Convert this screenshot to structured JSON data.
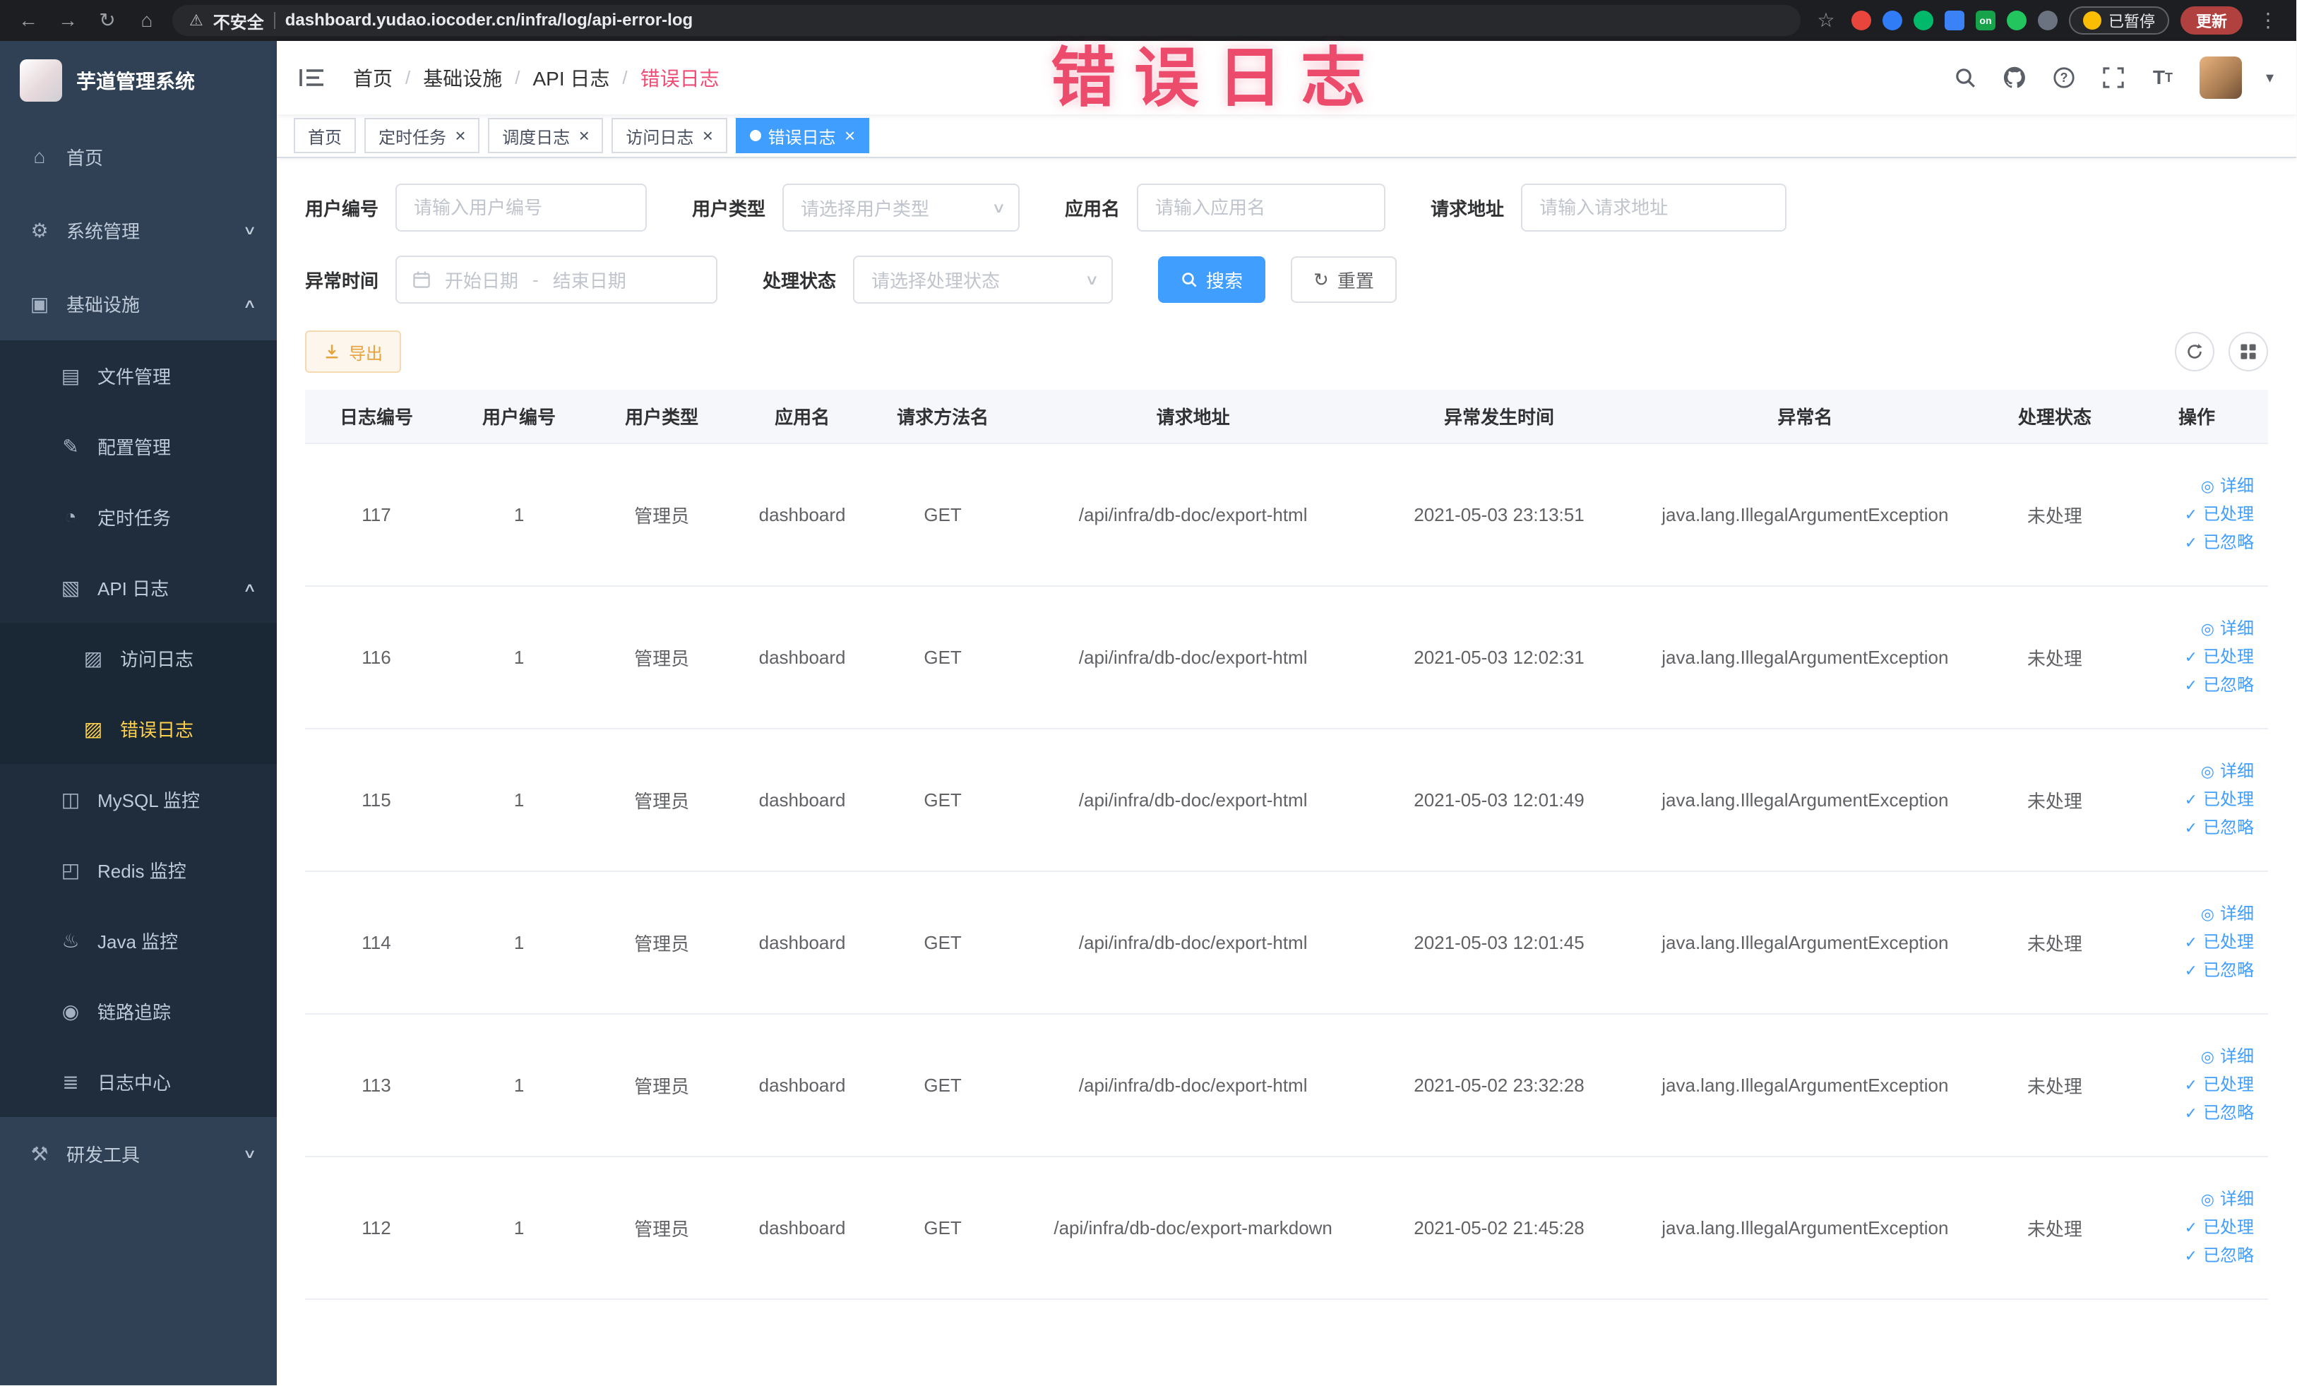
{
  "theme": {
    "primary": "#409eff",
    "warning": "#e6a23c",
    "sidebar_active": "#ffd04b",
    "annotation": "#ec4b6c"
  },
  "browser": {
    "security_label": "不安全",
    "url": "dashboard.yudao.iocoder.cn/infra/log/api-error-log",
    "paused_badge": "已暂停",
    "update_button": "更新",
    "extensions": [
      {
        "name": "extension-icon-red-circle",
        "color": "#e8453c",
        "shape": "circle"
      },
      {
        "name": "extension-icon-blue-drop",
        "color": "#2f7cf6",
        "shape": "circle"
      },
      {
        "name": "extension-icon-green-circle",
        "color": "#00b96b",
        "shape": "circle"
      },
      {
        "name": "extension-icon-blue-grid",
        "color": "#3b82f6",
        "shape": "square"
      },
      {
        "name": "extension-icon-on-badge",
        "color": "#16a34a",
        "shape": "square",
        "label": "on"
      },
      {
        "name": "extension-icon-green-leaf",
        "color": "#22c55e",
        "shape": "circle"
      },
      {
        "name": "extension-icon-dark-pin",
        "color": "#6b7280",
        "shape": "circle"
      }
    ]
  },
  "sidebar": {
    "logo_title": "芋道管理系统",
    "items": [
      {
        "key": "home",
        "label": "首页",
        "icon": "home-icon",
        "glyph": "home",
        "level": 1
      },
      {
        "key": "system",
        "label": "系统管理",
        "icon": "gear-icon",
        "glyph": "gear",
        "level": 1,
        "chevron": "down"
      },
      {
        "key": "infra",
        "label": "基础设施",
        "icon": "infra-icon",
        "glyph": "tree",
        "level": 1,
        "chevron": "up"
      },
      {
        "key": "file",
        "label": "文件管理",
        "icon": "file-manage-icon",
        "glyph": "folder",
        "level": 2
      },
      {
        "key": "config",
        "label": "配置管理",
        "icon": "config-edit-icon",
        "glyph": "edit",
        "level": 2
      },
      {
        "key": "job",
        "label": "定时任务",
        "icon": "timer-icon",
        "glyph": "clock",
        "level": 2
      },
      {
        "key": "api-log",
        "label": "API 日志",
        "icon": "api-log-icon",
        "glyph": "doc",
        "level": 2,
        "chevron": "up"
      },
      {
        "key": "access-log",
        "label": "访问日志",
        "icon": "access-log-icon",
        "glyph": "doc2",
        "level": 3
      },
      {
        "key": "error-log",
        "label": "错误日志",
        "icon": "error-log-icon",
        "glyph": "doc2",
        "level": 3,
        "active": true
      },
      {
        "key": "mysql",
        "label": "MySQL 监控",
        "icon": "mysql-monitor-icon",
        "glyph": "db",
        "level": 2
      },
      {
        "key": "redis",
        "label": "Redis 监控",
        "icon": "redis-monitor-icon",
        "glyph": "db2",
        "level": 2
      },
      {
        "key": "java",
        "label": "Java 监控",
        "icon": "java-monitor-icon",
        "glyph": "java",
        "level": 2
      },
      {
        "key": "trace",
        "label": "链路追踪",
        "icon": "trace-eye-icon",
        "glyph": "eye",
        "level": 2
      },
      {
        "key": "log-center",
        "label": "日志中心",
        "icon": "log-center-icon",
        "glyph": "list",
        "level": 2
      },
      {
        "key": "devtools",
        "label": "研发工具",
        "icon": "dev-tools-icon",
        "glyph": "tool",
        "level": 1,
        "chevron": "down"
      }
    ]
  },
  "header": {
    "breadcrumb": [
      "首页",
      "基础设施",
      "API 日志",
      "错误日志"
    ],
    "separator": "/"
  },
  "tabs": [
    {
      "key": "home",
      "label": "首页",
      "closable": false,
      "active": false
    },
    {
      "key": "job",
      "label": "定时任务",
      "closable": true,
      "active": false
    },
    {
      "key": "job-log",
      "label": "调度日志",
      "closable": true,
      "active": false
    },
    {
      "key": "access-log",
      "label": "访问日志",
      "closable": true,
      "active": false
    },
    {
      "key": "error-log",
      "label": "错误日志",
      "closable": true,
      "active": true
    }
  ],
  "filters": {
    "user_id": {
      "label": "用户编号",
      "placeholder": "请输入用户编号"
    },
    "user_type": {
      "label": "用户类型",
      "placeholder": "请选择用户类型"
    },
    "app_name": {
      "label": "应用名",
      "placeholder": "请输入应用名"
    },
    "request_url": {
      "label": "请求地址",
      "placeholder": "请输入请求地址"
    },
    "exception_time": {
      "label": "异常时间",
      "start_placeholder": "开始日期",
      "separator": "-",
      "end_placeholder": "结束日期"
    },
    "process_status": {
      "label": "处理状态",
      "placeholder": "请选择处理状态"
    },
    "search_button": "搜索",
    "reset_button": "重置"
  },
  "toolbar": {
    "export_label": "导出"
  },
  "table": {
    "headers": [
      "日志编号",
      "用户编号",
      "用户类型",
      "应用名",
      "请求方法名",
      "请求地址",
      "异常发生时间",
      "异常名",
      "处理状态",
      "操作"
    ],
    "actions": [
      {
        "key": "detail",
        "label": "详细",
        "icon": "view-detail-icon",
        "glyph": "view"
      },
      {
        "key": "mark-processed",
        "label": "已处理",
        "icon": "check-icon",
        "glyph": "check"
      },
      {
        "key": "mark-ignored",
        "label": "已忽略",
        "icon": "check-icon",
        "glyph": "check"
      }
    ],
    "rows": [
      {
        "log_id": "117",
        "user_id": "1",
        "user_type": "管理员",
        "app": "dashboard",
        "method": "GET",
        "url": "/api/infra/db-doc/export-html",
        "time": "2021-05-03 23:13:51",
        "exception": "java.lang.IllegalArgumentException",
        "status": "未处理"
      },
      {
        "log_id": "116",
        "user_id": "1",
        "user_type": "管理员",
        "app": "dashboard",
        "method": "GET",
        "url": "/api/infra/db-doc/export-html",
        "time": "2021-05-03 12:02:31",
        "exception": "java.lang.IllegalArgumentException",
        "status": "未处理"
      },
      {
        "log_id": "115",
        "user_id": "1",
        "user_type": "管理员",
        "app": "dashboard",
        "method": "GET",
        "url": "/api/infra/db-doc/export-html",
        "time": "2021-05-03 12:01:49",
        "exception": "java.lang.IllegalArgumentException",
        "status": "未处理"
      },
      {
        "log_id": "114",
        "user_id": "1",
        "user_type": "管理员",
        "app": "dashboard",
        "method": "GET",
        "url": "/api/infra/db-doc/export-html",
        "time": "2021-05-03 12:01:45",
        "exception": "java.lang.IllegalArgumentException",
        "status": "未处理"
      },
      {
        "log_id": "113",
        "user_id": "1",
        "user_type": "管理员",
        "app": "dashboard",
        "method": "GET",
        "url": "/api/infra/db-doc/export-html",
        "time": "2021-05-02 23:32:28",
        "exception": "java.lang.IllegalArgumentException",
        "status": "未处理"
      },
      {
        "log_id": "112",
        "user_id": "1",
        "user_type": "管理员",
        "app": "dashboard",
        "method": "GET",
        "url": "/api/infra/db-doc/export-markdown",
        "time": "2021-05-02 21:45:28",
        "exception": "java.lang.IllegalArgumentException",
        "status": "未处理"
      }
    ]
  },
  "annotation": {
    "text": "错误日志"
  }
}
